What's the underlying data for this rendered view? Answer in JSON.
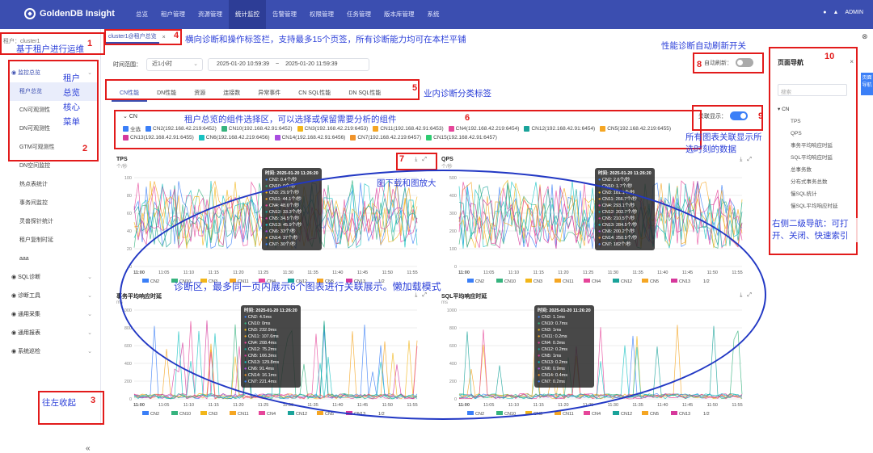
{
  "app": {
    "brand": "GoldenDB Insight",
    "user": "ADMIN"
  },
  "nav": [
    "总览",
    "租户管理",
    "资源管理",
    "统计监控",
    "告警管理",
    "权限管理",
    "任务管理",
    "版本库管理",
    "系统"
  ],
  "nav_active_index": 3,
  "sidebar": {
    "tenant_label": "租户：",
    "tenant_value": "cluster1",
    "items": [
      {
        "label": "监控总览",
        "type": "group-open"
      },
      {
        "label": "租户总览",
        "type": "selected"
      },
      {
        "label": "CN可观测性",
        "type": "item"
      },
      {
        "label": "DN可观测性",
        "type": "item"
      },
      {
        "label": "GTM可观测性",
        "type": "item"
      },
      {
        "label": "DN空间监控",
        "type": "item"
      },
      {
        "label": "热点表统计",
        "type": "item"
      },
      {
        "label": "事务间监控",
        "type": "item"
      },
      {
        "label": "灵兽探针统计",
        "type": "item"
      },
      {
        "label": "租户复制时延",
        "type": "item"
      },
      {
        "label": "aaa",
        "type": "item"
      },
      {
        "label": "SQL诊断",
        "type": "group"
      },
      {
        "label": "诊断工具",
        "type": "group"
      },
      {
        "label": "通用采集",
        "type": "group"
      },
      {
        "label": "通用报表",
        "type": "group"
      },
      {
        "label": "系统巡检",
        "type": "group"
      }
    ],
    "collapse": "«"
  },
  "tabs": [
    {
      "label": "cluster1@租户总览",
      "close": "×"
    }
  ],
  "filter": {
    "time_label": "时间范围：",
    "range": "近1小时",
    "start": "2025-01-20 10:59:39",
    "sep": "~",
    "end": "2025-01-20 11:59:39",
    "auto_label": "自动刷新："
  },
  "content_tabs": [
    "CN性能",
    "DN性能",
    "资源",
    "连接数",
    "异常事件",
    "CN SQL性能",
    "DN SQL性能"
  ],
  "relation_label": "关联显示：",
  "relation_on": "开",
  "components": {
    "header": "CN",
    "all": "全选",
    "list": [
      {
        "label": "CN2(192.168.42.219:6452)",
        "color": "#3b7ff7"
      },
      {
        "label": "CN10(192.168.42.91:6452)",
        "color": "#36b37e"
      },
      {
        "label": "CN3(192.168.42.219:6453)",
        "color": "#f2b619"
      },
      {
        "label": "CN11(192.168.42.91:6453)",
        "color": "#f5a623"
      },
      {
        "label": "CN4(192.168.42.219:6454)",
        "color": "#e6469a"
      },
      {
        "label": "CN12(192.168.42.91:6454)",
        "color": "#1aa39a"
      },
      {
        "label": "CN5(192.168.42.219:6455)",
        "color": "#f5a623"
      },
      {
        "label": "CN13(192.168.42.91:6455)",
        "color": "#d6389c"
      },
      {
        "label": "CN6(192.168.42.219:6456)",
        "color": "#17c2c2"
      },
      {
        "label": "CN14(192.168.42.91:6456)",
        "color": "#a94de0"
      },
      {
        "label": "CN7(192.168.42.219:6457)",
        "color": "#f0932b"
      },
      {
        "label": "CN15(192.168.42.91:6457)",
        "color": "#2ecc71"
      }
    ]
  },
  "charts": {
    "x_ticks": [
      "11:00",
      "11:05",
      "11:10",
      "11:15",
      "11:20",
      "11:25",
      "11:30",
      "11:35",
      "11:40",
      "11:45",
      "11:50",
      "11:55"
    ],
    "legend": [
      "CN2",
      "CN10",
      "CN3",
      "CN11",
      "CN4",
      "CN12",
      "CN5",
      "CN13"
    ],
    "legend_colors": [
      "#3b7ff7",
      "#36b37e",
      "#f2b619",
      "#f5a623",
      "#e6469a",
      "#1aa39a",
      "#f5a623",
      "#d6389c"
    ],
    "pager": "1/2",
    "tps": {
      "title": "TPS",
      "unit": "个/秒",
      "yticks": [
        "100",
        "80",
        "60",
        "40",
        "20",
        "0"
      ],
      "tooltip": {
        "title": "时间: 2025-01-20 11:26:20",
        "rows": [
          "CN2: 0.4个/秒",
          "CN10: 0个/秒",
          "CN3: 29.9个/秒",
          "CN11: 44.1个/秒",
          "CN4: 48.6个/秒",
          "CN12: 33.3个/秒",
          "CN5: 34.5个/秒",
          "CN13: 45.9个/秒",
          "CN6: 33个/秒",
          "CN14: 37个/秒",
          "CN7: 30个/秒"
        ]
      }
    },
    "qps": {
      "title": "QPS",
      "unit": "个/秒",
      "yticks": [
        "500",
        "400",
        "300",
        "200",
        "100",
        "0"
      ],
      "tooltip": {
        "title": "时间: 2025-01-20 11:26:20",
        "rows": [
          "CN2: 2.6个/秒",
          "CN10: 1.7个/秒",
          "CN3: 181.1个/秒",
          "CN11: 266.7个/秒",
          "CN4: 293.1个/秒",
          "CN12: 202.7个/秒",
          "CN5: 210.5个/秒",
          "CN13: 284.5个/秒",
          "CN6: 200.2个/秒",
          "CN14: 250.5个/秒",
          "CN7: 182个/秒"
        ]
      }
    },
    "txn": {
      "title": "事务平均响应时延",
      "unit": "ms",
      "yticks": [
        "1000",
        "800",
        "600",
        "400",
        "200",
        "0"
      ],
      "tooltip": {
        "title": "时间: 2025-01-20 11:26:20",
        "rows": [
          "CN2: 4.5ms",
          "CN10: 0ms",
          "CN3: 232.9ms",
          "CN11: 107.6ms",
          "CN4: 208.4ms",
          "CN12: 75.2ms",
          "CN5: 166.3ms",
          "CN13: 129.8ms",
          "CN6: 91.4ms",
          "CN14: 16.1ms",
          "CN7: 221.4ms"
        ]
      }
    },
    "sql": {
      "title": "SQL平均响应时延",
      "unit": "ms",
      "yticks": [
        "1000",
        "800",
        "600",
        "400",
        "200",
        "0"
      ],
      "tooltip": {
        "title": "时间: 2025-01-20 11:26:20",
        "rows": [
          "CN2: 1.1ms",
          "CN10: 0.7ms",
          "CN3: 1ms",
          "CN11: 0.2ms",
          "CN4: 0.3ms",
          "CN12: 0.2ms",
          "CN5: 1ms",
          "CN13: 0.2ms",
          "CN6: 0.9ms",
          "CN14: 0.4ms",
          "CN7: 0.2ms"
        ]
      }
    }
  },
  "right_panel": {
    "title": "页面导航",
    "close": "×",
    "search_placeholder": "搜索",
    "items": [
      {
        "label": "CN",
        "grp": true
      },
      {
        "label": "TPS"
      },
      {
        "label": "QPS"
      },
      {
        "label": "事务平均响应时延"
      },
      {
        "label": "SQL平均响应时延"
      },
      {
        "label": "总事务数"
      },
      {
        "label": "分布式事务总数"
      },
      {
        "label": "慢SQL统计"
      },
      {
        "label": "慢SQL平均响应时延"
      }
    ],
    "tab": "页面导航"
  },
  "annotations": {
    "n1": "1",
    "t1": "基于租户进行运维",
    "n2": "2",
    "t2": "租户总览核心菜单",
    "n3": "3",
    "t3": "往左收起",
    "n4": "4",
    "t4": "横向诊断和操作标签栏，支持最多15个页签，所有诊断能力均可在本栏平铺",
    "t_auto": "性能诊断自动刷新开关",
    "n5": "5",
    "t5": "业内诊断分类标签",
    "n6": "6",
    "t6": "租户总览的组件选择区，可以选择或保留需要分析的组件",
    "n7": "7",
    "t7": "图下载和图放大",
    "n8": "8",
    "n9": "9",
    "t9": "所有图表关联显示所选时刻的数据",
    "n10": "10",
    "t10": "右侧二级导航：可打开、关闭、快速索引",
    "t_ellipse": "诊断区，最多同一页内展示6个图表进行关联展示。懒加载模式"
  }
}
